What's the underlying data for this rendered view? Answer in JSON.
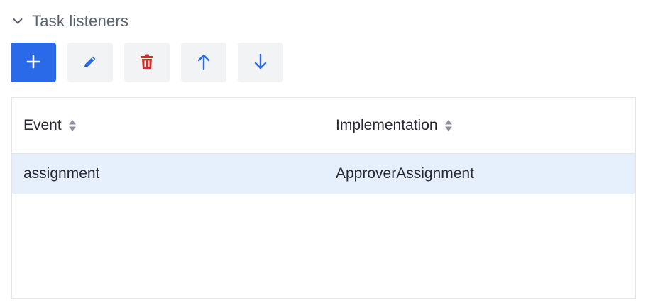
{
  "section": {
    "title": "Task listeners",
    "expanded": true
  },
  "toolbar": {
    "buttons": [
      {
        "name": "add",
        "icon": "plus-icon"
      },
      {
        "name": "edit",
        "icon": "pencil-icon"
      },
      {
        "name": "delete",
        "icon": "trash-icon"
      },
      {
        "name": "move-up",
        "icon": "arrow-up-icon"
      },
      {
        "name": "move-down",
        "icon": "arrow-down-icon"
      }
    ]
  },
  "table": {
    "columns": [
      {
        "label": "Event",
        "sortable": true
      },
      {
        "label": "Implementation",
        "sortable": true
      }
    ],
    "rows": [
      {
        "event": "assignment",
        "implementation": "ApproverAssignment",
        "selected": true
      }
    ]
  },
  "colors": {
    "primary": "#2a6ae9",
    "icon_blue": "#2a6ae9",
    "delete_red": "#c9302c",
    "selected_row": "#e6effc",
    "border": "#e3e5e9",
    "header_text": "#5b6270",
    "text": "#262a33"
  }
}
